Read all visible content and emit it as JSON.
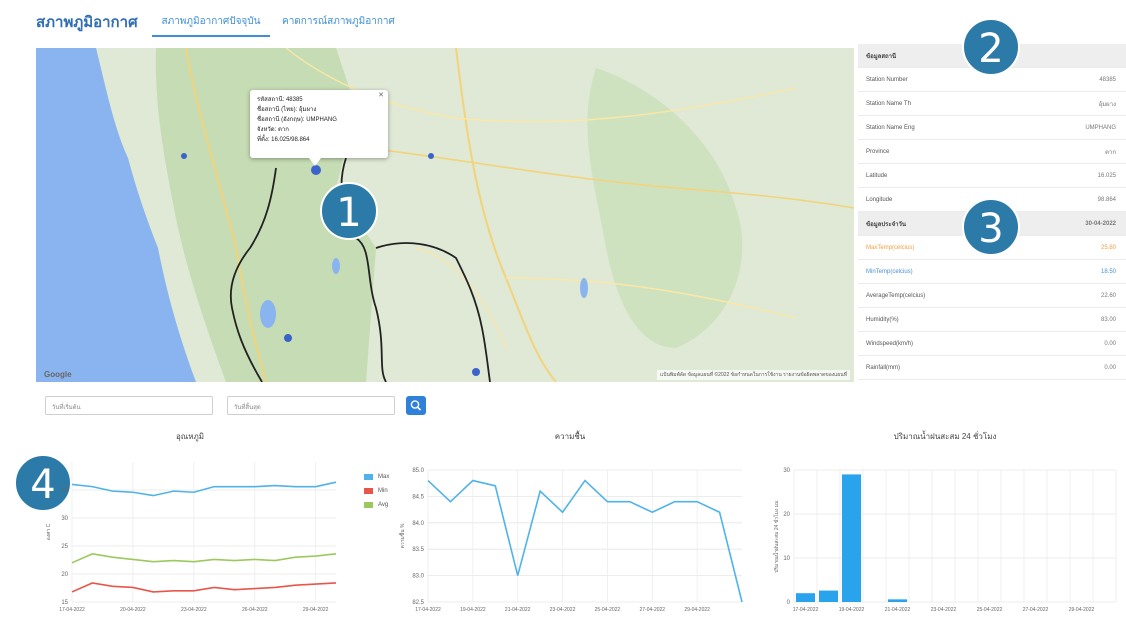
{
  "header": {
    "title": "สภาพภูมิอากาศ",
    "tabs": [
      {
        "label": "สภาพภูมิอากาศปัจจุบัน",
        "active": true
      },
      {
        "label": "คาดการณ์สภาพภูมิอากาศ",
        "active": false
      }
    ]
  },
  "map": {
    "popup": {
      "lines": [
        "รหัสสถานี: 48385",
        "ชื่อสถานี (ไทย): อุ้มผาง",
        "ชื่อสถานี (อังกฤษ): UMPHANG",
        "จังหวัด: ตาก",
        "ที่ตั้ง: 16.025/98.864"
      ]
    },
    "footer": "แป้นพิมพ์ลัด  ข้อมูลแผนที่ ©2022  ข้อกำหนดในการใช้งาน  รายงานข้อผิดพลาดของแผนที่",
    "logo": "Google"
  },
  "badges": [
    "1",
    "2",
    "3",
    "4"
  ],
  "info": {
    "station_rows": [
      {
        "label": "ข้อมูลสถานี",
        "value": "",
        "head": true
      },
      {
        "label": "Station Number",
        "value": "48385"
      },
      {
        "label": "Station Name Th",
        "value": "อุ้มผาง"
      },
      {
        "label": "Station Name Eng",
        "value": "UMPHANG"
      },
      {
        "label": "Province",
        "value": "ตาก"
      },
      {
        "label": "Latitude",
        "value": "16.025"
      },
      {
        "label": "Longitude",
        "value": "98.864"
      }
    ],
    "weather_rows": [
      {
        "label": "ข้อมูลประจำวัน",
        "value": "30-04-2022",
        "head": true
      },
      {
        "label": "MaxTemp(celcius)",
        "value": "25.80",
        "style": "orange"
      },
      {
        "label": "MinTemp(celcius)",
        "value": "18.50",
        "style": "blue"
      },
      {
        "label": "AverageTemp(celcius)",
        "value": "22.60"
      },
      {
        "label": "Humidity(%)",
        "value": "83.00"
      },
      {
        "label": "Windspeed(km/h)",
        "value": "0.00"
      },
      {
        "label": "Rainfall(mm)",
        "value": "0.00"
      }
    ]
  },
  "filters": {
    "start_placeholder": "วันที่เริ่มต้น",
    "end_placeholder": "วันที่สิ้นสุด"
  },
  "colors": {
    "max": "#4fb3ea",
    "min": "#e8564a",
    "avg": "#9cc95e",
    "humidity": "#4fb3ea",
    "rain": "#29a3ec"
  },
  "chart_data": [
    {
      "type": "line",
      "title": "อุณหภูมิ",
      "ylabel": "องศา C",
      "ylim": [
        15,
        40
      ],
      "yticks": [
        15,
        20,
        25,
        30,
        35
      ],
      "categories": [
        "17-04-2022",
        "18-04-2022",
        "19-04-2022",
        "20-04-2022",
        "21-04-2022",
        "22-04-2022",
        "23-04-2022",
        "24-04-2022",
        "25-04-2022",
        "26-04-2022",
        "27-04-2022",
        "28-04-2022",
        "29-04-2022",
        "30-04-2022"
      ],
      "xtick_labels": [
        "17-04-2022",
        "20-04-2022",
        "23-04-2022",
        "26-04-2022",
        "29-04-2022"
      ],
      "series": [
        {
          "name": "Max",
          "values": [
            36.0,
            35.6,
            34.8,
            34.6,
            34.0,
            34.8,
            34.6,
            35.6,
            35.6,
            35.6,
            35.8,
            35.6,
            35.6,
            36.4
          ]
        },
        {
          "name": "Min",
          "values": [
            16.8,
            18.4,
            17.8,
            17.6,
            16.8,
            17.0,
            17.0,
            17.6,
            17.2,
            17.4,
            17.6,
            18.0,
            18.2,
            18.4
          ]
        },
        {
          "name": "Avg",
          "values": [
            22.0,
            23.6,
            23.0,
            22.6,
            22.2,
            22.4,
            22.2,
            22.6,
            22.4,
            22.6,
            22.4,
            23.0,
            23.2,
            23.6
          ]
        }
      ],
      "legend_position": "right"
    },
    {
      "type": "line",
      "title": "ความชื้น",
      "ylabel": "ความชื้น %",
      "ylim": [
        82.5,
        85.0
      ],
      "yticks": [
        82.5,
        83.0,
        83.5,
        84.0,
        84.5,
        85.0
      ],
      "categories": [
        "17-04-2022",
        "18-04-2022",
        "19-04-2022",
        "20-04-2022",
        "21-04-2022",
        "22-04-2022",
        "23-04-2022",
        "24-04-2022",
        "25-04-2022",
        "26-04-2022",
        "27-04-2022",
        "28-04-2022",
        "29-04-2022",
        "30-04-2022"
      ],
      "xtick_labels": [
        "17-04-2022",
        "19-04-2022",
        "21-04-2022",
        "23-04-2022",
        "25-04-2022",
        "27-04-2022",
        "29-04-2022"
      ],
      "series": [
        {
          "name": "",
          "values": [
            84.8,
            84.4,
            84.8,
            84.7,
            83.0,
            84.6,
            84.2,
            84.8,
            84.4,
            84.4,
            84.2,
            84.4,
            84.4,
            84.2,
            82.5
          ]
        }
      ]
    },
    {
      "type": "bar",
      "title": "ปริมาณน้ำฝนสะสม 24 ชั่วโมง",
      "ylabel": "ปริมาณน้ำฝนสะสม 24 ชั่วโมง มม.",
      "ylim": [
        0,
        30
      ],
      "yticks": [
        0,
        10,
        20,
        30
      ],
      "categories": [
        "17-04-2022",
        "18-04-2022",
        "19-04-2022",
        "20-04-2022",
        "21-04-2022",
        "22-04-2022",
        "23-04-2022",
        "24-04-2022",
        "25-04-2022",
        "26-04-2022",
        "27-04-2022",
        "28-04-2022",
        "29-04-2022",
        "30-04-2022"
      ],
      "xtick_labels": [
        "17-04-2022",
        "19-04-2022",
        "21-04-2022",
        "23-04-2022",
        "25-04-2022",
        "27-04-2022",
        "29-04-2022"
      ],
      "values": [
        2.0,
        2.6,
        29.0,
        0,
        0.6,
        0,
        0,
        0,
        0,
        0,
        0,
        0,
        0,
        0
      ]
    }
  ]
}
